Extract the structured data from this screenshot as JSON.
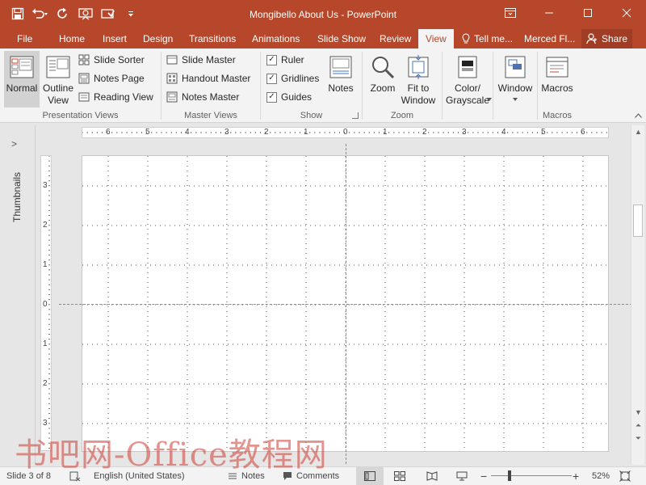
{
  "window": {
    "title": "Mongibello About Us - PowerPoint",
    "accent": "#b7472a"
  },
  "quick_access": [
    {
      "icon": "save-icon"
    },
    {
      "icon": "undo-icon"
    },
    {
      "icon": "redo-icon"
    },
    {
      "icon": "start-from-beginning-icon"
    },
    {
      "icon": "touch-mode-icon"
    },
    {
      "icon": "customize-qat-icon"
    }
  ],
  "tabs": [
    "File",
    "Home",
    "Insert",
    "Design",
    "Transitions",
    "Animations",
    "Slide Show",
    "Review",
    "View"
  ],
  "active_tab": "View",
  "tell_me": "Tell me...",
  "user_name": "Merced Fl...",
  "share_label": "Share",
  "ribbon": {
    "presentation_views": {
      "label": "Presentation Views",
      "normal": "Normal",
      "outline_line1": "Outline",
      "outline_line2": "View",
      "slide_sorter": "Slide Sorter",
      "notes_page": "Notes Page",
      "reading_view": "Reading View"
    },
    "master_views": {
      "label": "Master Views",
      "slide_master": "Slide Master",
      "handout_master": "Handout Master",
      "notes_master": "Notes Master"
    },
    "show": {
      "label": "Show",
      "ruler": "Ruler",
      "ruler_checked": true,
      "gridlines": "Gridlines",
      "gridlines_checked": true,
      "guides": "Guides",
      "guides_checked": true,
      "notes": "Notes"
    },
    "zoom": {
      "label": "Zoom",
      "zoom": "Zoom",
      "fit_line1": "Fit to",
      "fit_line2": "Window"
    },
    "color": {
      "line1": "Color/",
      "line2": "Grayscale"
    },
    "window": {
      "label": "Window"
    },
    "macros": {
      "label": "Macros",
      "button": "Macros"
    }
  },
  "thumbnails_label": "Thumbnails",
  "ruler": {
    "horizontal": [
      "6",
      "5",
      "4",
      "3",
      "2",
      "1",
      "0",
      "1",
      "2",
      "3",
      "4",
      "5",
      "6"
    ],
    "vertical": [
      "3",
      "2",
      "1",
      "0",
      "1",
      "2",
      "3"
    ]
  },
  "status": {
    "slide_info": "Slide 3 of 8",
    "language": "English (United States)",
    "notes": "Notes",
    "comments": "Comments",
    "zoom_level": "52%",
    "zoom_fraction": 0.52
  },
  "watermark": "书吧网-Office教程网"
}
